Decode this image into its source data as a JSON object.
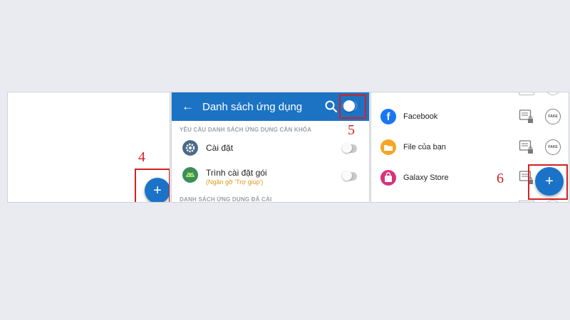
{
  "panel1": {
    "fab_label": "+",
    "step": "4"
  },
  "panel2": {
    "title": "Danh sách ứng dụng",
    "step": "5",
    "section_lock": "YÊU CẦU DANH SÁCH ỨNG DỤNG CẦN KHÓA",
    "section_locked": "DANH SÁCH ỨNG DỤNG ĐÃ CÀI",
    "items": [
      {
        "label": "Cài đặt",
        "sub": ""
      },
      {
        "label": "Trình cài đặt gói",
        "sub": "(Ngăn gỡ 'Trợ giúp')"
      }
    ]
  },
  "panel3": {
    "step": "6",
    "fab_label": "+",
    "fake_label": "FAKE",
    "apps": [
      {
        "label": "Facebook"
      },
      {
        "label": "File của bạn"
      },
      {
        "label": "Galaxy Store"
      }
    ]
  },
  "colors": {
    "accent": "#1c73c4",
    "highlight": "#d52020",
    "sub_text": "#e09a22"
  }
}
